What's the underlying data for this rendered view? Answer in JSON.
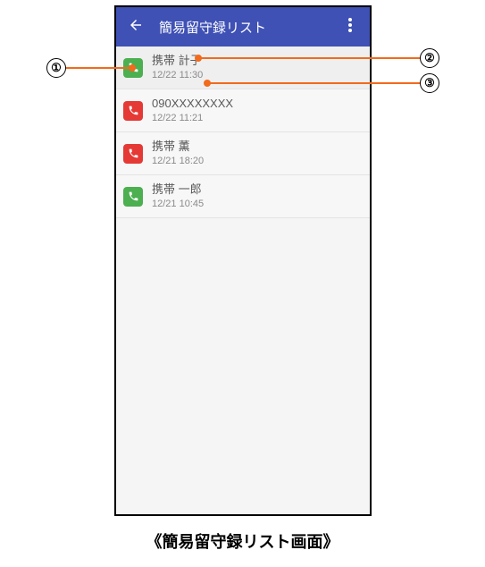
{
  "appbar": {
    "title": "簡易留守録リスト"
  },
  "items": [
    {
      "name": "携帯 計子",
      "time": "12/22 11:30",
      "color": "green"
    },
    {
      "name": "090XXXXXXXX",
      "time": "12/22 11:21",
      "color": "red"
    },
    {
      "name": "携帯 薫",
      "time": "12/21 18:20",
      "color": "red"
    },
    {
      "name": "携帯 一郎",
      "time": "12/21 10:45",
      "color": "green"
    }
  ],
  "annotations": {
    "1": "①",
    "2": "②",
    "3": "③"
  },
  "caption": "《簡易留守録リスト画面》"
}
